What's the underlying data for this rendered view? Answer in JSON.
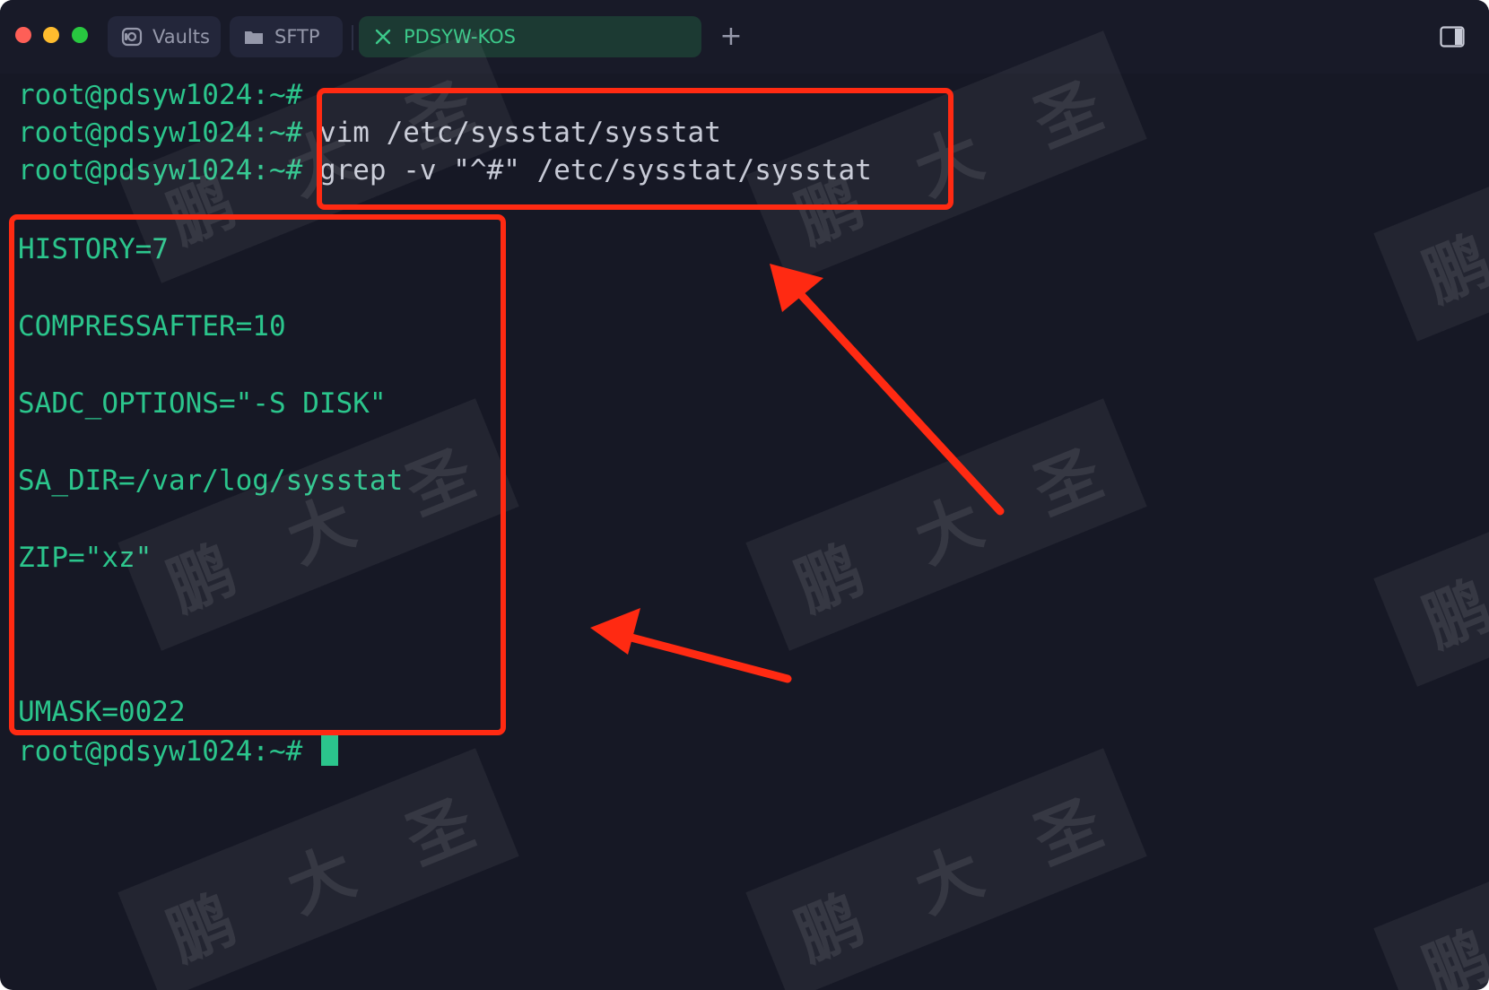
{
  "titlebar": {
    "tabs": [
      {
        "label": "Vaults",
        "icon": "vault-icon"
      },
      {
        "label": "SFTP",
        "icon": "folder-icon"
      }
    ],
    "active_tab": {
      "label": "PDSYW-KOS",
      "icon": "terminal-x-icon"
    },
    "new_tab_label": "+",
    "sidebar_icon": "sidebar-toggle-icon"
  },
  "terminal": {
    "prompt": "root@pdsyw1024:~#",
    "lines": [
      {
        "prompt": "root@pdsyw1024:~#",
        "command": ""
      },
      {
        "prompt": "root@pdsyw1024:~#",
        "command": " vim /etc/sysstat/sysstat"
      },
      {
        "prompt": "root@pdsyw1024:~#",
        "command": " grep -v \"^#\" /etc/sysstat/sysstat"
      }
    ],
    "output": [
      "HISTORY=7",
      "COMPRESSAFTER=10",
      "SADC_OPTIONS=\"-S DISK\"",
      "SA_DIR=/var/log/sysstat",
      "ZIP=\"xz\"",
      "UMASK=0022"
    ],
    "final_prompt": "root@pdsyw1024:~#"
  },
  "watermark_text": [
    "鹏",
    "大",
    "圣"
  ],
  "colors": {
    "background": "#161825",
    "terminal_text": "#2bc58c",
    "annotation": "#ff2a12",
    "active_tab": "#1c3a33"
  }
}
